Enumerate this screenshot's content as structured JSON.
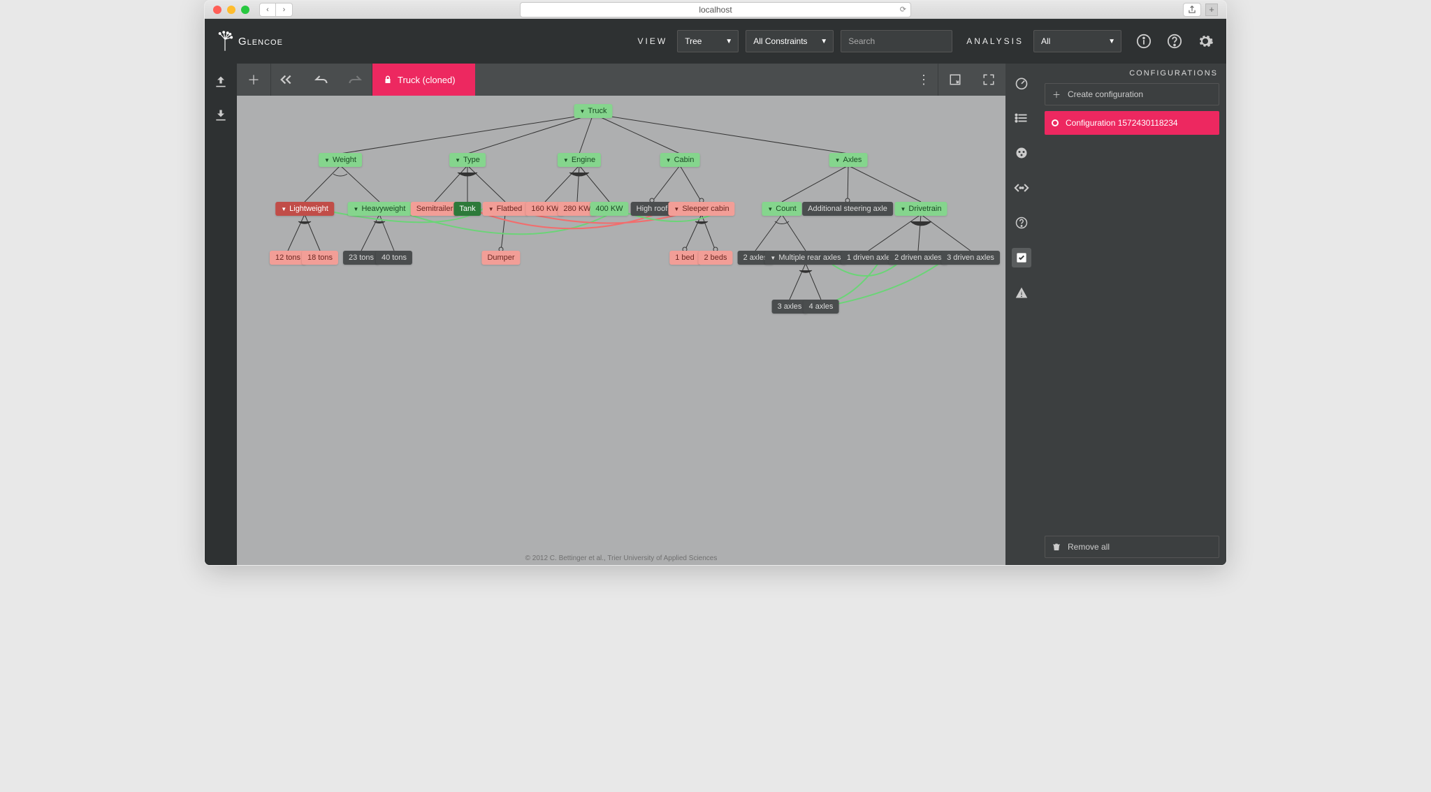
{
  "browser": {
    "url": "localhost"
  },
  "app": {
    "name": "Glencoe"
  },
  "topbar": {
    "view_label": "VIEW",
    "view_value": "Tree",
    "constraints_value": "All Constraints",
    "search_placeholder": "Search",
    "analysis_label": "ANALYSIS",
    "analysis_value": "All"
  },
  "tab": {
    "label": "Truck (cloned)"
  },
  "footer": "© 2012 C. Bettinger et al., Trier University of Applied Sciences",
  "config": {
    "header": "CONFIGURATIONS",
    "create_label": "Create configuration",
    "item_label": "Configuration 1572430118234",
    "remove_label": "Remove all"
  },
  "nodes": {
    "truck": "Truck",
    "weight": "Weight",
    "type": "Type",
    "engine": "Engine",
    "cabin": "Cabin",
    "axles": "Axles",
    "lightweight": "Lightweight",
    "heavyweight": "Heavyweight",
    "semitrailer": "Semitrailer",
    "tank": "Tank",
    "flatbed": "Flatbed",
    "kw160": "160 KW",
    "kw280": "280 KW",
    "kw400": "400 KW",
    "highroof": "High roof",
    "sleeper": "Sleeper cabin",
    "count": "Count",
    "addsteer": "Additional steering axle",
    "drivetrain": "Drivetrain",
    "t12": "12 tons",
    "t18": "18 tons",
    "t23": "23 tons",
    "t40": "40 tons",
    "dumper": "Dumper",
    "bed1": "1 bed",
    "bed2": "2 beds",
    "ax2": "2 axles",
    "axmulti": "Multiple rear axles",
    "d1": "1 driven axle",
    "d2": "2 driven axles",
    "d3": "3 driven axles",
    "ax3": "3 axles",
    "ax4": "4 axles"
  }
}
